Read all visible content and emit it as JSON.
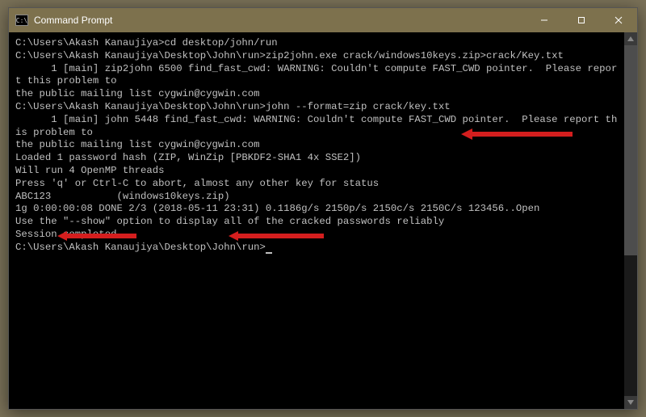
{
  "window": {
    "title": "Command Prompt",
    "icon_text": "C:\\"
  },
  "terminal": {
    "lines": [
      "",
      "C:\\Users\\Akash Kanaujiya>cd desktop/john/run",
      "",
      "C:\\Users\\Akash Kanaujiya\\Desktop\\John\\run>zip2john.exe crack/windows10keys.zip>crack/Key.txt",
      "      1 [main] zip2john 6500 find_fast_cwd: WARNING: Couldn't compute FAST_CWD pointer.  Please report this problem to",
      "the public mailing list cygwin@cygwin.com",
      "",
      "C:\\Users\\Akash Kanaujiya\\Desktop\\John\\run>john --format=zip crack/key.txt",
      "      1 [main] john 5448 find_fast_cwd: WARNING: Couldn't compute FAST_CWD pointer.  Please report this problem to",
      "the public mailing list cygwin@cygwin.com",
      "Loaded 1 password hash (ZIP, WinZip [PBKDF2-SHA1 4x SSE2])",
      "Will run 4 OpenMP threads",
      "Press 'q' or Ctrl-C to abort, almost any other key for status",
      "ABC123           (windows10keys.zip)",
      "1g 0:00:00:08 DONE 2/3 (2018-05-11 23:31) 0.1186g/s 2150p/s 2150c/s 2150C/s 123456..Open",
      "Use the \"--show\" option to display all of the cracked passwords reliably",
      "Session completed",
      "",
      "C:\\Users\\Akash Kanaujiya\\Desktop\\John\\run>"
    ]
  },
  "annotations": {
    "color": "#d41e1e"
  }
}
